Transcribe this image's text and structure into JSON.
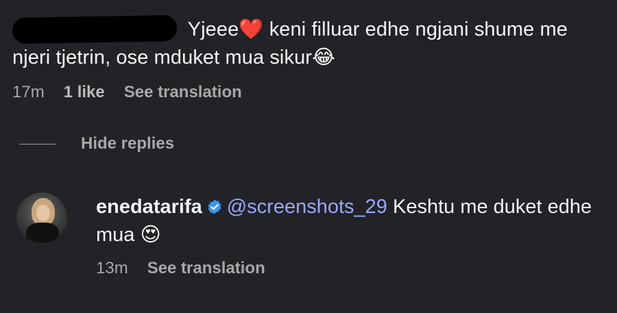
{
  "comment": {
    "text_after_name": " Yjeee",
    "heart_emoji": "❤️",
    "text_mid": "  keni filluar edhe ngjani shume me njeri tjetrin, ose mduket mua sikur",
    "laugh_emoji": "😂",
    "time": "17m",
    "likes": "1 like",
    "see_translation": "See translation"
  },
  "thread": {
    "hide_replies": "Hide replies"
  },
  "reply": {
    "username": "enedatarifa",
    "mention": "@screenshots_29",
    "text": " Keshtu me duket edhe mua ",
    "emoji": "😍",
    "time": "13m",
    "see_translation": "See translation"
  },
  "colors": {
    "background": "#222327",
    "text": "#f5f5f5",
    "muted": "#a8a8a8",
    "mention": "#9aa8ff",
    "verified": "#3897f0"
  }
}
